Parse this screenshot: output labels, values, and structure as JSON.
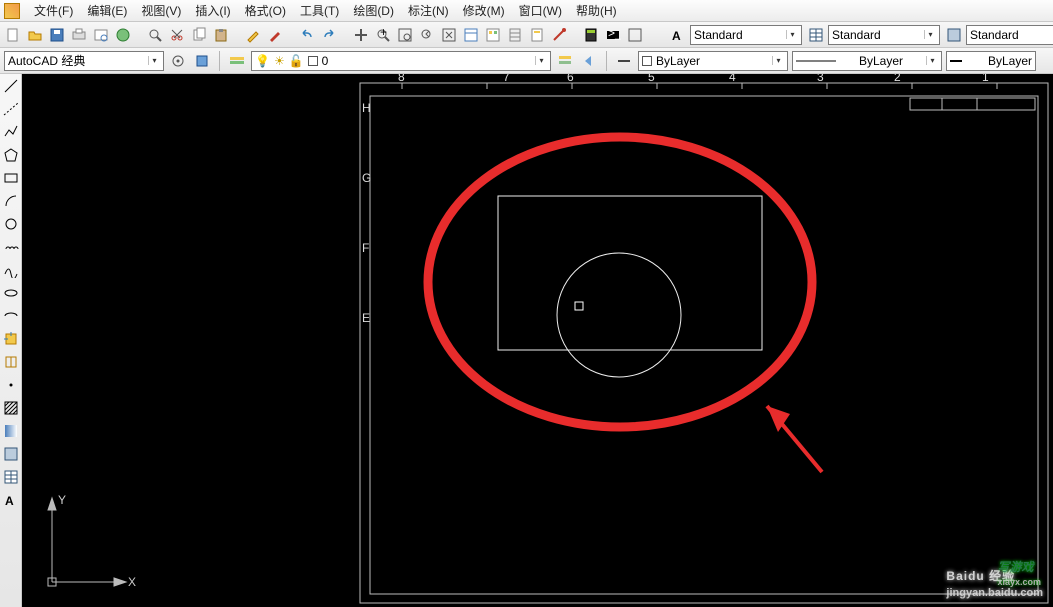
{
  "menubar": {
    "items": [
      {
        "label": "文件(F)"
      },
      {
        "label": "编辑(E)"
      },
      {
        "label": "视图(V)"
      },
      {
        "label": "插入(I)"
      },
      {
        "label": "格式(O)"
      },
      {
        "label": "工具(T)"
      },
      {
        "label": "绘图(D)"
      },
      {
        "label": "标注(N)"
      },
      {
        "label": "修改(M)"
      },
      {
        "label": "窗口(W)"
      },
      {
        "label": "帮助(H)"
      }
    ]
  },
  "toolbar1": {
    "icons": [
      "new-file",
      "open-folder",
      "save",
      "plot",
      "print-preview",
      "publish",
      "find",
      "cut",
      "copy",
      "paste",
      "match-props",
      "paintbrush",
      "undo",
      "redo",
      "pan",
      "zoom-realtime",
      "zoom-window",
      "zoom-previous",
      "zoom-extents",
      "properties",
      "design-center",
      "tool-palettes",
      "sheet-set",
      "markup",
      "quickcalc",
      "command-line",
      "clean-screen"
    ],
    "textstyle_icon": "text-style-icon",
    "textstyle": "Standard",
    "dimstyle_icon": "dim-style-icon",
    "dimstyle": "Standard",
    "tablestyle_icon": "table-style-icon",
    "tablestyle": "Standard"
  },
  "toolbar2": {
    "workspace": "AutoCAD 经典",
    "workspace_icons": [
      "workspace-settings",
      "workspace-save"
    ],
    "layer_tool_icon": "layer-properties",
    "layer_status_icons": [
      "bulb",
      "sun",
      "lock",
      "color"
    ],
    "layer": "0",
    "layer_right_icons": [
      "layer-states",
      "layer-previous"
    ],
    "linetype_icon": "linetype-icon",
    "linetype": "ByLayer",
    "lineweight": "ByLayer",
    "color": "ByLayer"
  },
  "left_toolbar": {
    "tools": [
      "line",
      "construction-line",
      "polyline",
      "polygon",
      "rectangle",
      "arc",
      "circle",
      "revision-cloud",
      "spline",
      "ellipse",
      "ellipse-arc",
      "insert-block",
      "make-block",
      "point",
      "hatch",
      "gradient",
      "region",
      "table",
      "multiline-text"
    ]
  },
  "canvas": {
    "ucs": {
      "x_label": "X",
      "y_label": "Y"
    },
    "ruler_numbers": [
      "8",
      "7",
      "6",
      "5",
      "4",
      "3",
      "2",
      "1"
    ],
    "ruler_side_letters": [
      "H",
      "G",
      "F",
      "E"
    ]
  },
  "watermark": {
    "main": "Baidu 经验",
    "sub": "jingyan.baidu.com"
  },
  "watermark2": {
    "main": "写游戏",
    "sub": "xiayx.com"
  }
}
